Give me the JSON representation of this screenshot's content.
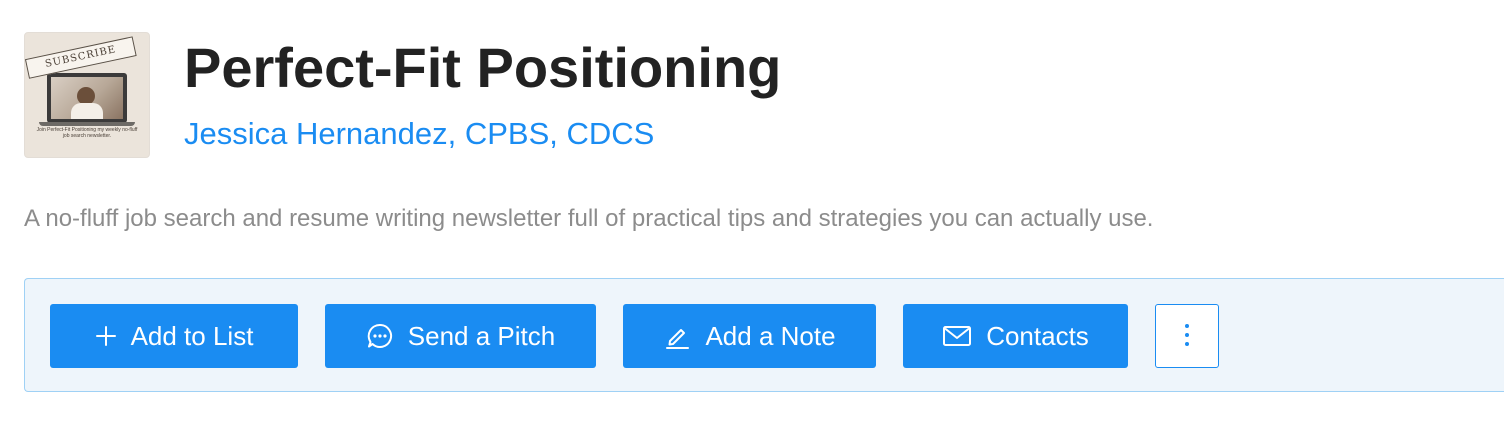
{
  "newsletter": {
    "thumbnail": {
      "banner_text": "SUBSCRIBE",
      "caption": "Join Perfect-Fit Positioning my weekly no-fluff job search newsletter."
    },
    "title": "Perfect-Fit Positioning",
    "author": "Jessica Hernandez, CPBS, CDCS",
    "description": "A no-fluff job search and resume writing newsletter full of practical tips and strategies you can actually use."
  },
  "actions": {
    "add_to_list": {
      "label": "Add to List",
      "icon": "plus-icon"
    },
    "send_pitch": {
      "label": "Send a Pitch",
      "icon": "chat-bubble-icon"
    },
    "add_note": {
      "label": "Add a Note",
      "icon": "pencil-icon"
    },
    "contacts": {
      "label": "Contacts",
      "icon": "envelope-icon"
    },
    "more": {
      "icon": "vertical-ellipsis-icon"
    }
  },
  "colors": {
    "accent": "#1a8cf2",
    "title": "#222222",
    "description": "#8c8c8c",
    "action_bar_bg": "#eef5fb",
    "action_bar_border": "#9fd1f5"
  }
}
